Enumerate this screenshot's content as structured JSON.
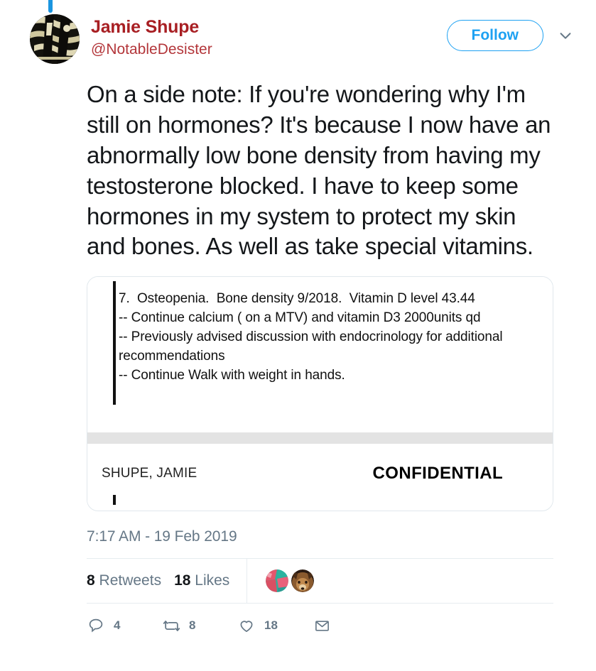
{
  "thread": {
    "connector_color": "#1b95e0"
  },
  "author": {
    "display_name": "Jamie Shupe",
    "handle": "@NotableDesister",
    "name_color": "#a81f23",
    "avatar_icon": "user-avatar-image"
  },
  "header": {
    "follow_label": "Follow",
    "follow_color": "#1da1f2",
    "caret_icon": "chevron-down-icon"
  },
  "tweet": {
    "text": "On a side note: If you're wondering why I'm still on hormones? It's because I now have an abnormally low bone density from having my testosterone blocked. I have to keep some hormones in my system to protect my skin and bones. As well as take special vitamins."
  },
  "media": {
    "document": {
      "lines": [
        "7.  Osteopenia.  Bone density 9/2018.  Vitamin D level 43.44",
        "-- Continue calcium ( on a MTV) and vitamin D3 2000units qd",
        "-- Previously advised discussion with endocrinology for additional",
        "recommendations",
        "-- Continue Walk with weight in hands."
      ],
      "patient_name": "SHUPE, JAMIE",
      "classification": "CONFIDENTIAL",
      "band_color": "#e3e3e3"
    }
  },
  "meta": {
    "timestamp": "7:17 AM - 19 Feb 2019"
  },
  "stats": {
    "retweets_count": "8",
    "retweets_label": "Retweets",
    "likes_count": "18",
    "likes_label": "Likes",
    "facepile": [
      {
        "name": "liker-avatar-1"
      },
      {
        "name": "liker-avatar-2"
      }
    ]
  },
  "actions": [
    {
      "icon": "reply-icon",
      "count": "4"
    },
    {
      "icon": "retweet-icon",
      "count": "8"
    },
    {
      "icon": "like-heart-icon",
      "count": "18"
    },
    {
      "icon": "direct-message-envelope-icon",
      "count": ""
    }
  ]
}
